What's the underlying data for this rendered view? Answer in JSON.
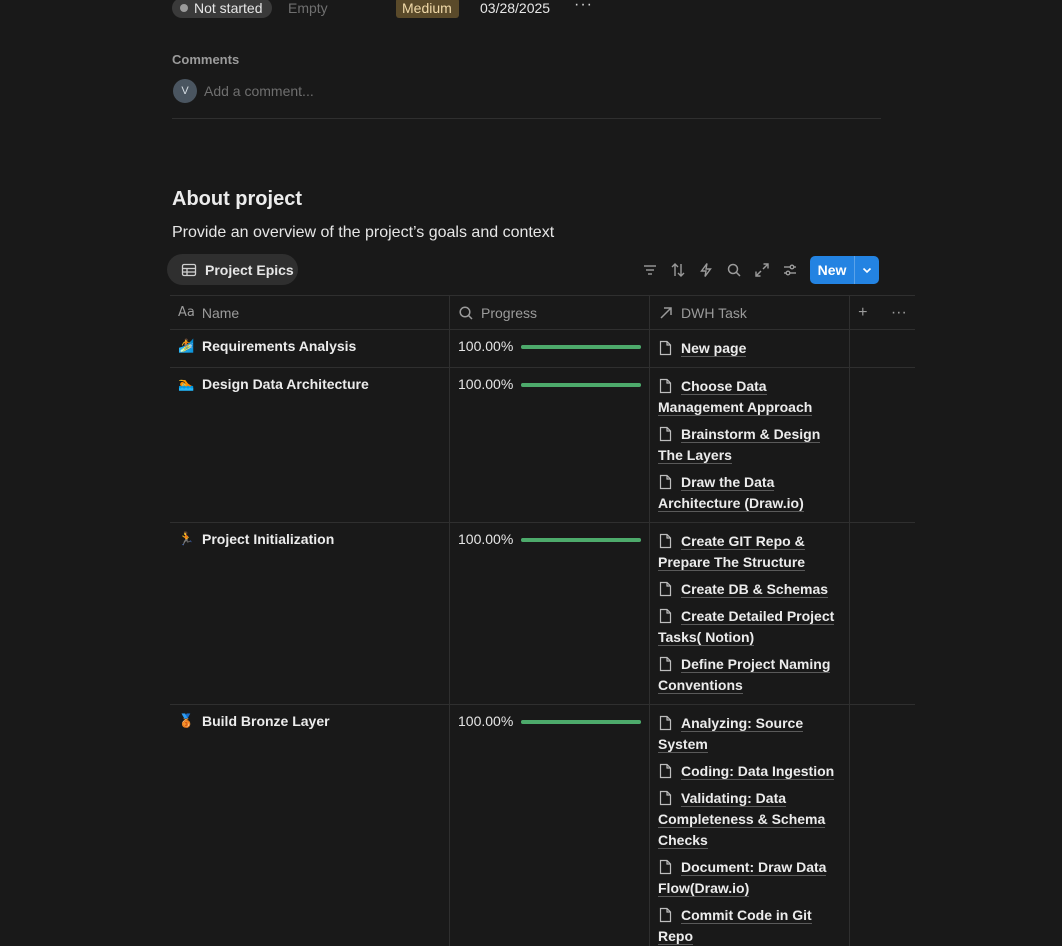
{
  "properties": {
    "status": "Not started",
    "assignee_placeholder": "Empty",
    "priority": "Medium",
    "date": "03/28/2025",
    "more": "···"
  },
  "comments": {
    "label": "Comments",
    "avatar_initial": "V",
    "placeholder": "Add a comment..."
  },
  "section": {
    "title": "About project",
    "description": "Provide an overview of the project’s goals and context"
  },
  "view": {
    "tab_label": "Project Epics",
    "new_label": "New"
  },
  "columns": {
    "name": "Name",
    "progress": "Progress",
    "task": "DWH Task",
    "add": "+",
    "more": "···"
  },
  "rows": [
    {
      "icon": "surfing-icon",
      "icon_glyph": "🏄",
      "name": "Requirements Analysis",
      "progress_text": "100.00%",
      "progress": 1.0,
      "tasks": [
        "New page"
      ]
    },
    {
      "icon": "swimmer-icon",
      "icon_glyph": "🏊",
      "name": "Design Data Architecture",
      "progress_text": "100.00%",
      "progress": 1.0,
      "tasks": [
        "Choose Data Management Approach",
        "Brainstorm & Design The Layers",
        "Draw the Data Architecture (Draw.io)"
      ]
    },
    {
      "icon": "runner-icon",
      "icon_glyph": "🏃",
      "name": "Project Initialization",
      "progress_text": "100.00%",
      "progress": 1.0,
      "tasks": [
        "Create GIT Repo & Prepare The Structure",
        "Create DB & Schemas",
        "Create Detailed Project Tasks( Notion)",
        "Define Project Naming Conventions"
      ]
    },
    {
      "icon": "bronze-medal-icon",
      "icon_glyph": "🥉",
      "name": "Build Bronze Layer",
      "progress_text": "100.00%",
      "progress": 1.0,
      "tasks": [
        "Analyzing: Source System",
        "Coding: Data Ingestion",
        "Validating: Data Completeness & Schema Checks",
        "Document: Draw Data Flow(Draw.io)",
        "Commit Code in Git Repo"
      ]
    }
  ]
}
